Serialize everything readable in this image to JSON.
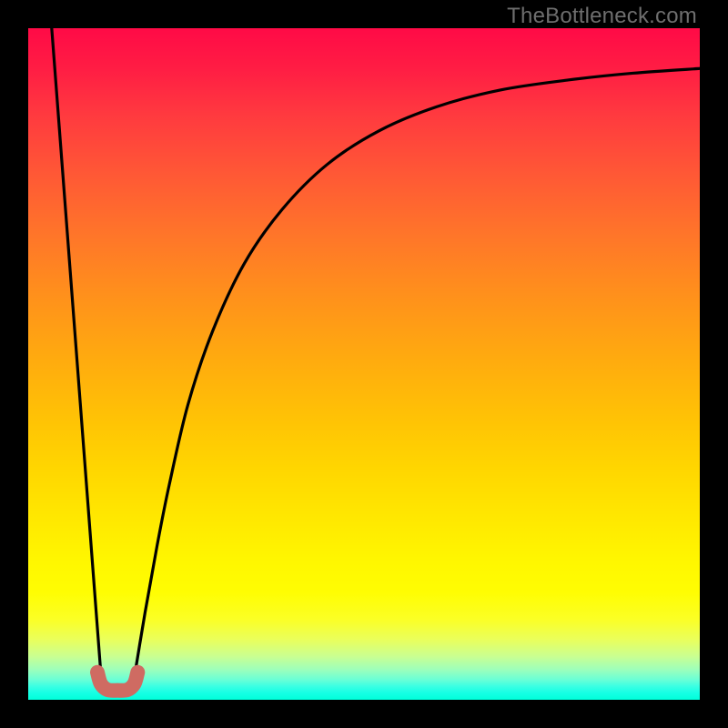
{
  "watermark": "TheBottleneck.com",
  "colors": {
    "frame": "#000000",
    "curve": "#000000",
    "marker": "#cf6b62"
  },
  "chart_data": {
    "type": "line",
    "title": "",
    "xlabel": "",
    "ylabel": "",
    "xlim": [
      0,
      100
    ],
    "ylim": [
      0,
      100
    ],
    "note": "Axes have no ticks or labels; values are approximated from pixels on a 0–100 canvas for both axes, with y=0 at the bottom.",
    "series": [
      {
        "name": "left-descending-line",
        "x": [
          3.5,
          11.0
        ],
        "y": [
          100,
          1.5
        ]
      },
      {
        "name": "right-curve",
        "x": [
          15.5,
          17.4,
          19.2,
          21.0,
          23.8,
          27.5,
          32.2,
          37.8,
          44.5,
          52.2,
          60.8,
          70.3,
          80.5,
          90.0,
          100.0
        ],
        "y": [
          1.5,
          13.0,
          23.0,
          32.0,
          44.0,
          55.0,
          65.0,
          73.0,
          79.7,
          84.7,
          88.3,
          90.8,
          92.3,
          93.3,
          94.0
        ]
      },
      {
        "name": "marker-u",
        "x": [
          10.3,
          10.8,
          11.8,
          13.3,
          14.8,
          15.8,
          16.3
        ],
        "y": [
          4.1,
          2.4,
          1.5,
          1.4,
          1.5,
          2.4,
          4.1
        ]
      }
    ]
  }
}
